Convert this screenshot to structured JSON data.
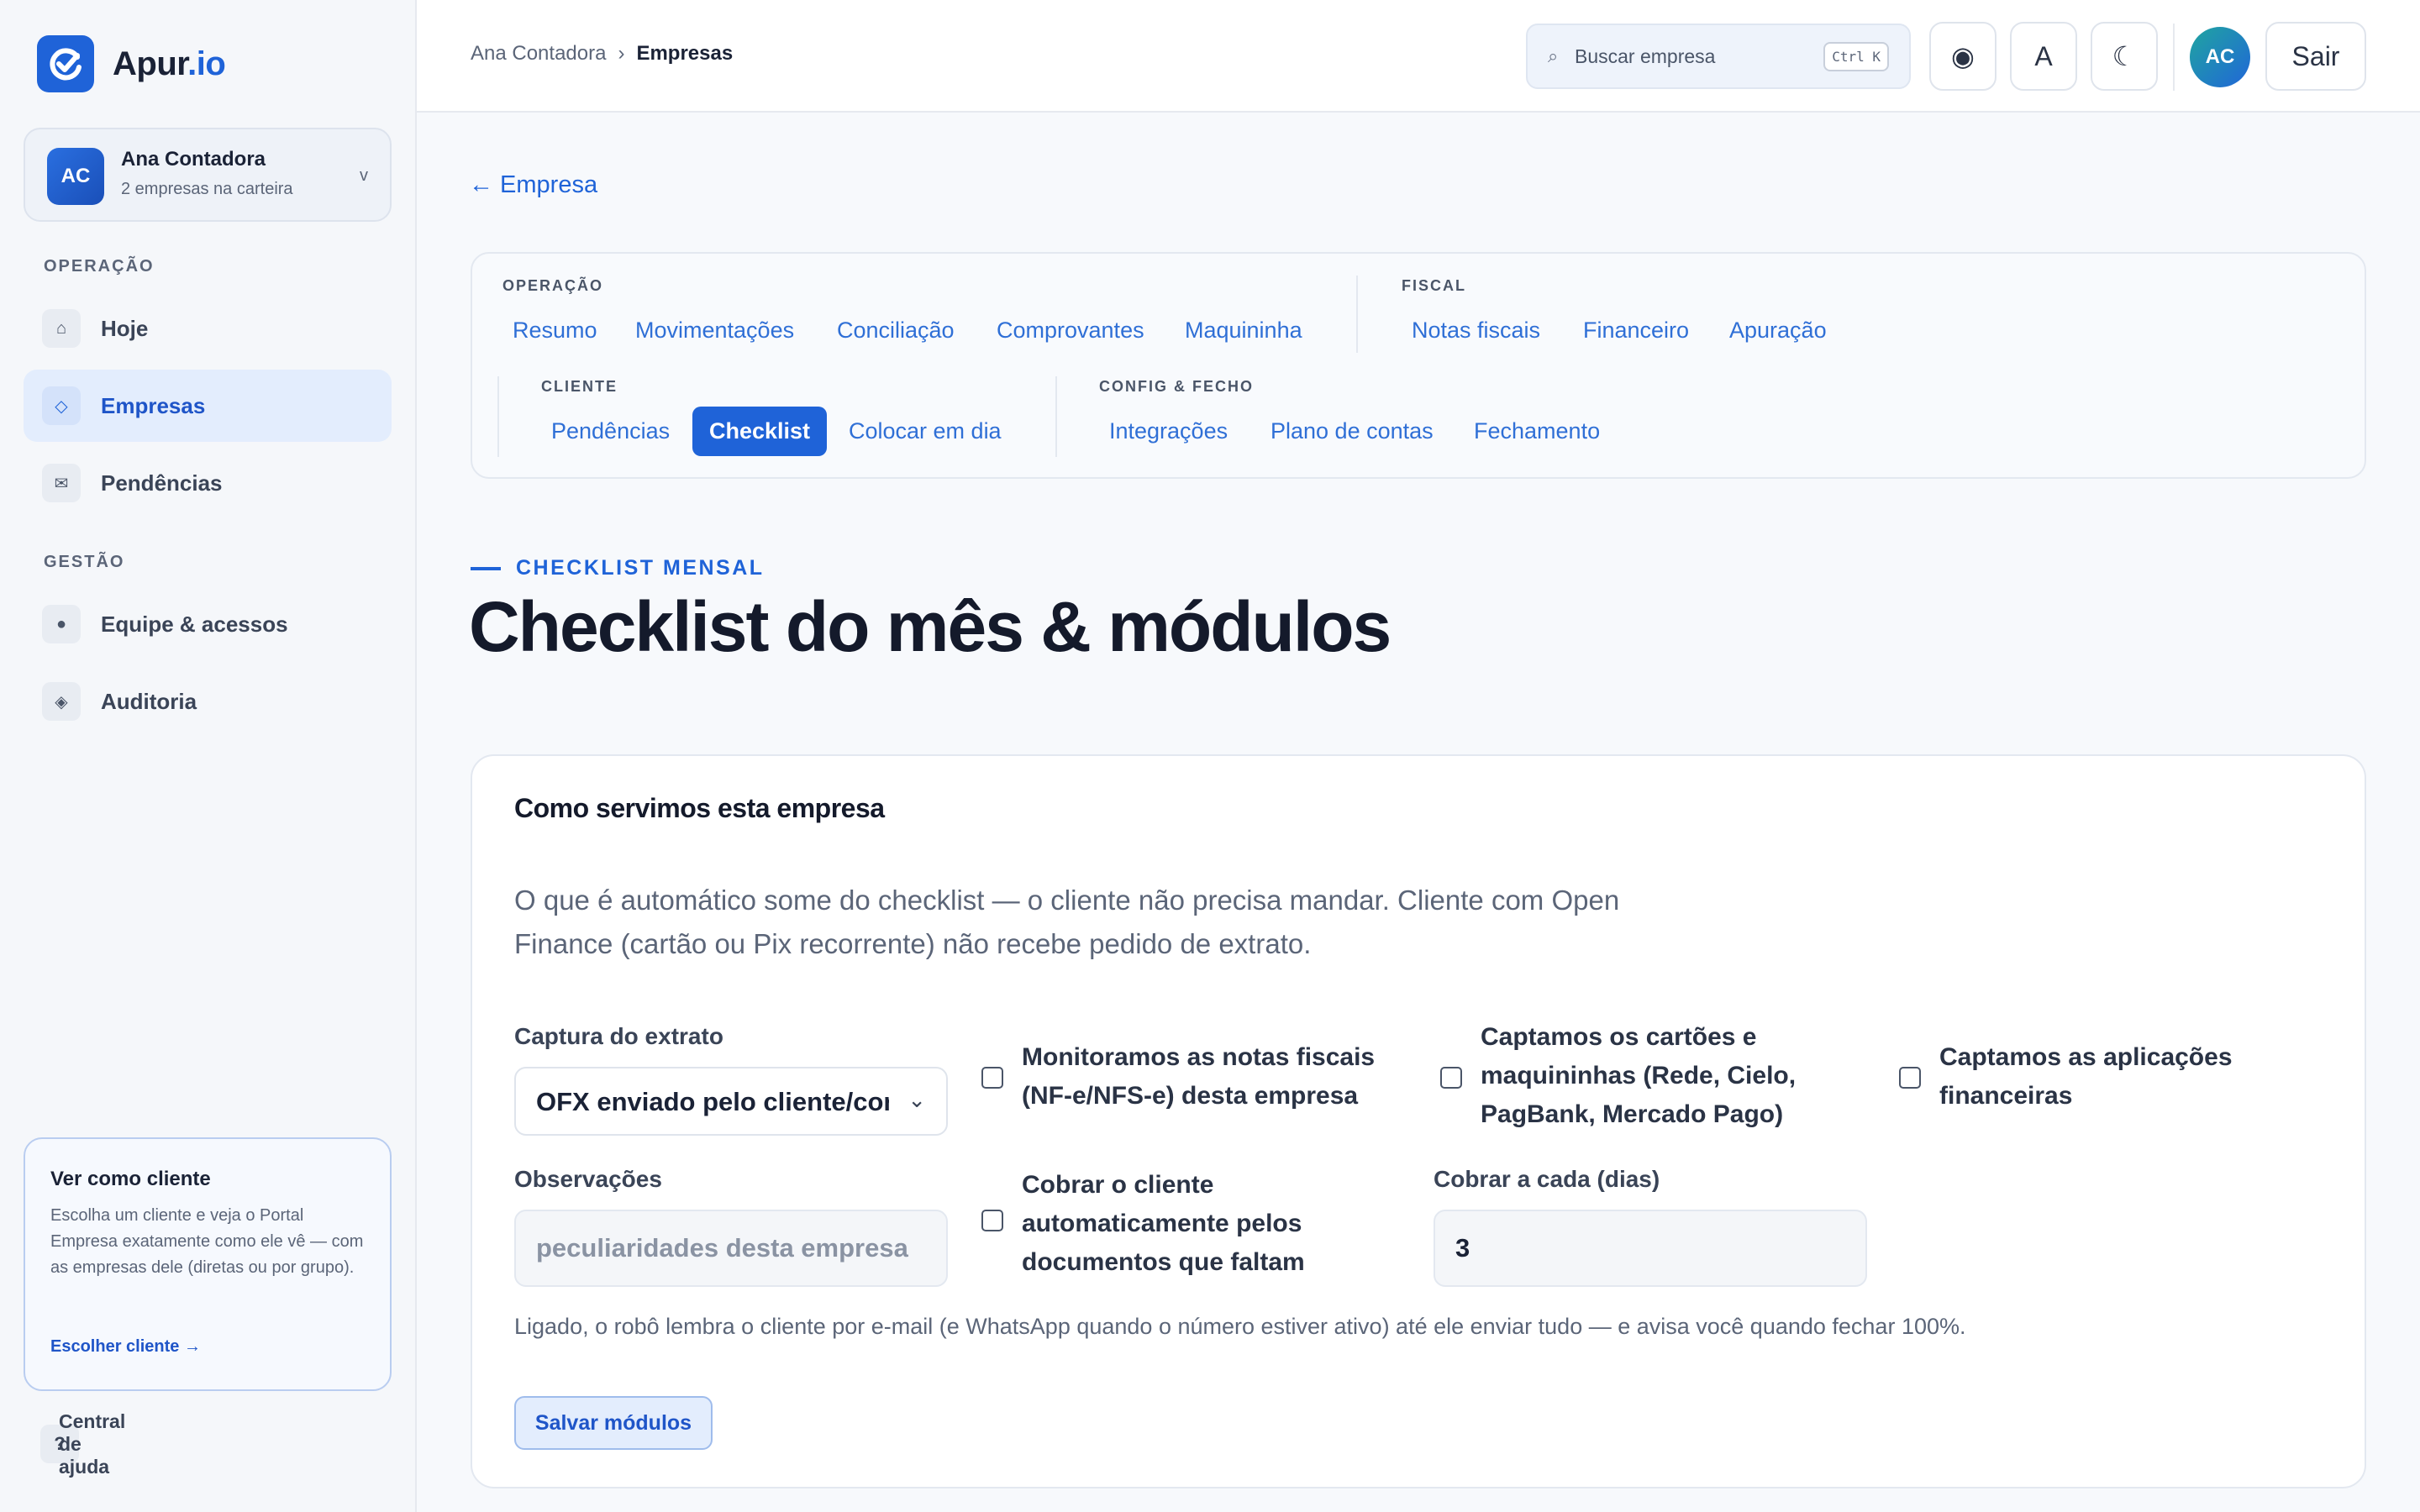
{
  "brand": {
    "name_main": "Apur",
    "name_suffix": ".io",
    "accent": "#1f63d8"
  },
  "account": {
    "initials": "AC",
    "name": "Ana Contadora",
    "subtitle": "2 empresas na carteira",
    "caret": "v"
  },
  "sidebar": {
    "section_ops": "OPERAÇÃO",
    "section_mgmt": "GESTÃO",
    "items": [
      {
        "label": "Hoje",
        "icon": "home-icon"
      },
      {
        "label": "Empresas",
        "icon": "diamond-icon",
        "active": true
      },
      {
        "label": "Pendências",
        "icon": "mail-icon"
      },
      {
        "label": "Equipe & acessos",
        "icon": "person-icon"
      },
      {
        "label": "Auditoria",
        "icon": "shield-icon"
      }
    ],
    "client_card": {
      "title": "Ver como cliente",
      "description": "Escolha um cliente e veja o Portal Empresa exatamente como ele vê — com as empresas dele (diretas ou por grupo).",
      "link": "Escolher cliente →"
    },
    "help": {
      "icon": "?",
      "label": "Central de ajuda"
    }
  },
  "topbar": {
    "breadcrumb": [
      "Ana Contadora",
      "Empresas"
    ],
    "breadcrumb_sep": "›",
    "search_placeholder": "Buscar empresa",
    "search_shortcut": "Ctrl K",
    "user_initials": "AC",
    "logout_label": "Sair",
    "icon_a": "A"
  },
  "back_link": "← Empresa",
  "tabs": {
    "operacao": {
      "label": "OPERAÇÃO",
      "items": [
        "Resumo",
        "Movimentações",
        "Conciliação",
        "Comprovantes",
        "Maquininha"
      ]
    },
    "fiscal": {
      "label": "FISCAL",
      "items": [
        "Notas fiscais",
        "Financeiro",
        "Apuração"
      ]
    },
    "cliente": {
      "label": "CLIENTE",
      "items": [
        "Pendências",
        "Checklist",
        "Colocar em dia"
      ],
      "active": "Checklist"
    },
    "config": {
      "label": "CONFIG & FECHO",
      "items": [
        "Integrações",
        "Plano de contas",
        "Fechamento"
      ]
    }
  },
  "page": {
    "eyebrow": "CHECKLIST MENSAL",
    "title": "Checklist do mês & módulos"
  },
  "card": {
    "title": "Como servimos esta empresa",
    "description": "O que é automático some do checklist — o cliente não precisa mandar. Cliente com Open Finance (cartão ou Pix recorrente) não recebe pedido de extrato.",
    "capture_label": "Captura do extrato",
    "capture_value": "OFX enviado pelo cliente/contador",
    "check_nf": "Monitoramos as notas fiscais (NF-e/NFS-e) desta empresa",
    "check_cards": "Captamos os cartões e maquininhas (Rede, Cielo, PagBank, Mercado Pago)",
    "check_apps": "Captamos as aplicações financeiras",
    "obs_label": "Observações",
    "obs_placeholder": "peculiaridades desta empresa",
    "check_charge": "Cobrar o cliente automaticamente pelos documentos que faltam",
    "interval_label": "Cobrar a cada (dias)",
    "interval_value": "3",
    "note": "Ligado, o robô lembra o cliente por e-mail (e WhatsApp quando o número estiver ativo) até ele enviar tudo — e avisa você quando fechar 100%.",
    "save_label": "Salvar módulos"
  }
}
